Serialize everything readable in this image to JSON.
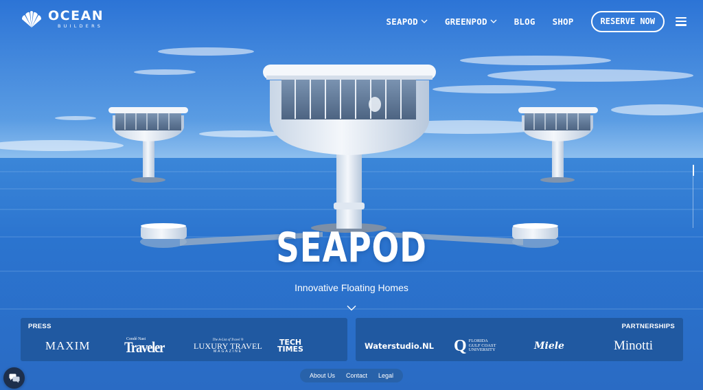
{
  "brand": {
    "name": "OCEAN",
    "subtitle": "BUILDERS",
    "logo_icon": "shell-icon"
  },
  "nav": {
    "items": [
      {
        "label": "SEAPOD",
        "has_dropdown": true
      },
      {
        "label": "GREENPOD",
        "has_dropdown": true
      },
      {
        "label": "BLOG",
        "has_dropdown": false
      },
      {
        "label": "SHOP",
        "has_dropdown": false
      }
    ],
    "reserve_label": "RESERVE NOW",
    "menu_icon": "hamburger-icon"
  },
  "hero": {
    "title": "SEAPOD",
    "subtitle": "Innovative Floating Homes",
    "scroll_icon": "chevron-down-icon"
  },
  "press": {
    "label": "PRESS",
    "logos": {
      "maxim": "MAXIM",
      "traveler_small": "Condé Nast",
      "traveler": "Traveler",
      "luxury_small": "The A-List of Travel ®",
      "luxury": "LUXURY TRAVEL",
      "luxury_mag": "MAGAZINE",
      "tech_1": "TECH",
      "tech_2": "TIMES"
    }
  },
  "partnerships": {
    "label": "PARTNERSHIPS",
    "logos": {
      "waterstudio": "Waterstudio.NL",
      "florida_q": "Q",
      "florida_1": "FLORIDA",
      "florida_2": "GULF COAST",
      "florida_3": "UNIVERSITY",
      "miele": "Miele",
      "minotti": "Minotti"
    }
  },
  "footer": {
    "links": [
      "About Us",
      "Contact",
      "Legal"
    ]
  },
  "chat": {
    "icon": "chat-bubbles-icon"
  },
  "colors": {
    "sky_top": "#2f7bd9",
    "sea": "#2e6fc8",
    "panel": "#1e5498",
    "chat": "#1d2f4c"
  }
}
